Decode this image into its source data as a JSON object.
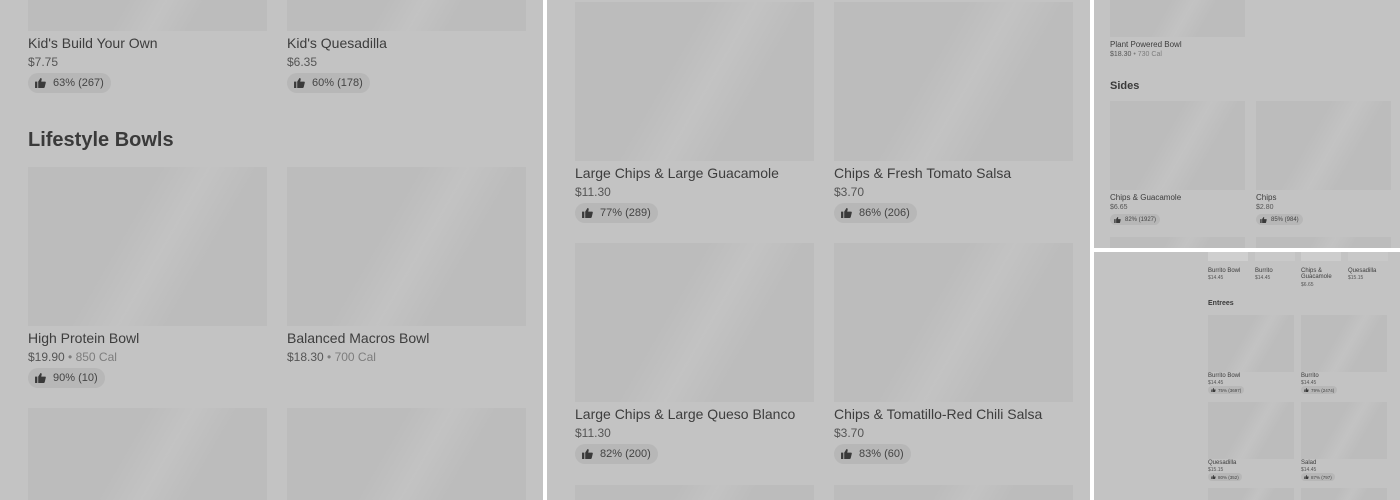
{
  "panel1": {
    "section_title": "Lifestyle Bowls",
    "items": [
      {
        "name": "Kid's Build Your Own",
        "price": "$7.75",
        "rating": "63% (267)"
      },
      {
        "name": "Kid's Quesadilla",
        "price": "$6.35",
        "rating": "60% (178)"
      },
      {
        "name": "High Protein Bowl",
        "price": "$19.90",
        "cal": " • 850 Cal",
        "rating": "90% (10)"
      },
      {
        "name": "Balanced Macros Bowl",
        "price": "$18.30",
        "cal": " • 700 Cal"
      }
    ]
  },
  "panel2": {
    "items": [
      {
        "name": "Large Chips & Large Guacamole",
        "price": "$11.30",
        "rating": "77% (289)"
      },
      {
        "name": "Chips & Fresh Tomato Salsa",
        "price": "$3.70",
        "rating": "86% (206)"
      },
      {
        "name": "Large Chips & Large Queso Blanco",
        "price": "$11.30",
        "rating": "82% (200)"
      },
      {
        "name": "Chips & Tomatillo-Red Chili Salsa",
        "price": "$3.70",
        "rating": "83% (60)"
      }
    ]
  },
  "panel3": {
    "top_item": {
      "name": "Plant Powered Bowl",
      "price": "$18.30",
      "cal": " • 730 Cal"
    },
    "section_title": "Sides",
    "items": [
      {
        "name": "Chips & Guacamole",
        "price": "$6.65",
        "rating": "82% (1927)"
      },
      {
        "name": "Chips",
        "price": "$2.80",
        "rating": "85% (984)"
      }
    ]
  },
  "panel4": {
    "top_items": [
      {
        "name": "Burrito Bowl",
        "price": "$14.45"
      },
      {
        "name": "Burrito",
        "price": "$14.45"
      },
      {
        "name": "Chips & Guacamole",
        "price": "$6.65"
      },
      {
        "name": "Quesadilla",
        "price": "$15.15"
      }
    ],
    "section_title": "Entrees",
    "items": [
      {
        "name": "Burrito Bowl",
        "price": "$14.45",
        "rating": "75% (3697)"
      },
      {
        "name": "Burrito",
        "price": "$14.45",
        "rating": "79% (2474)"
      },
      {
        "name": "Quesadilla",
        "price": "$15.15",
        "rating": "80% (352)"
      },
      {
        "name": "Salad",
        "price": "$14.45",
        "rating": "87% (797)"
      }
    ]
  }
}
